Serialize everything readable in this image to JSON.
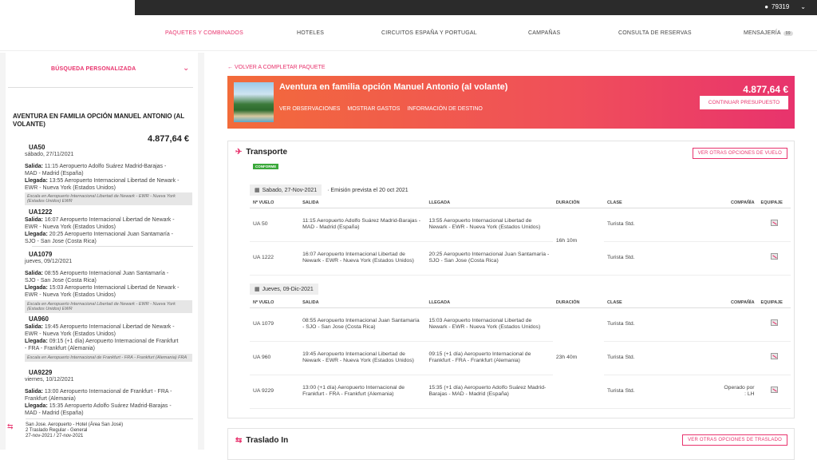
{
  "topbar": {
    "user_id": "79319"
  },
  "nav": {
    "items": [
      "PAQUETES Y COMBINADOS",
      "HOTELES",
      "CIRCUITOS ESPAÑA Y PORTUGAL",
      "CAMPAÑAS",
      "CONSULTA DE RESERVAS",
      "MENSAJERÍA"
    ],
    "badge": "99"
  },
  "sidebar": {
    "title": "BÚSQUEDA PERSONALIZADA",
    "trip_title": "AVENTURA EN FAMILIA OPCIÓN MANUEL ANTONIO (AL VOLANTE)",
    "price": "4.877,64 €",
    "salida_label": "Salida:",
    "llegada_label": "Llegada:",
    "legs": [
      {
        "code": "UA50",
        "date": "sábado, 27/11/2021",
        "salida": "11:15 Aeropuerto Adolfo Suárez Madrid-Barajas - MAD - Madrid (España)",
        "llegada": "13:55 Aeropuerto Internacional Libertad de Newark - EWR - Nueva York (Estados Unidos)",
        "stop": "Escala en Aeropuerto Internacional Libertad de Newark - EWR - Nueva York (Estados Unidos) EWR"
      },
      {
        "code": "UA1222",
        "date": "",
        "salida": "16:07 Aeropuerto Internacional Libertad de Newark - EWR - Nueva York (Estados Unidos)",
        "llegada": "20:25 Aeropuerto Internacional Juan Santamaría - SJO - San Jose (Costa Rica)",
        "stop": ""
      },
      {
        "code": "UA1079",
        "date": "jueves, 09/12/2021",
        "salida": "08:55 Aeropuerto Internacional Juan Santamaría - SJO - San Jose (Costa Rica)",
        "llegada": "15:03 Aeropuerto Internacional Libertad de Newark - EWR - Nueva York (Estados Unidos)",
        "stop": "Escala en Aeropuerto Internacional Libertad de Newark - EWR - Nueva York (Estados Unidos) EWR"
      },
      {
        "code": "UA960",
        "date": "",
        "salida": "19:45 Aeropuerto Internacional Libertad de Newark - EWR - Nueva York (Estados Unidos)",
        "llegada": "09:15 (+1 día) Aeropuerto Internacional de Frankfurt - FRA - Frankfurt (Alemania)",
        "stop": "Escala en Aeropuerto Internacional de Frankfurt - FRA - Frankfurt (Alemania) FRA"
      },
      {
        "code": "UA9229",
        "date": "viernes, 10/12/2021",
        "salida": "13:00 Aeropuerto Internacional de Frankfurt - FRA - Frankfurt (Alemania)",
        "llegada": "15:35 Aeropuerto Adolfo Suárez Madrid-Barajas - MAD - Madrid (España)",
        "stop": ""
      }
    ],
    "transfer": {
      "title": "San Jose. Aeropuerto - Hotel (Área San José)",
      "line2": "2 Traslado Regular - General",
      "dates": "27-nov-2021 / 27-nov-2021"
    }
  },
  "main": {
    "back_link": "VOLVER A COMPLETAR PAQUETE",
    "hero": {
      "title": "Aventura en familia opción Manuel Antonio (al volante)",
      "links": [
        "VER OBSERVACIONES",
        "MOSTRAR GASTOS",
        "INFORMACIÓN DE DESTINO"
      ],
      "price": "4.877,64 €",
      "button": "CONTINUAR PRESUPUESTO"
    },
    "transport": {
      "title": "Transporte",
      "options_button": "VER OTRAS OPCIONES DE VUELO",
      "status": "CONFORME",
      "columns": [
        "Nº VUELO",
        "SALIDA",
        "LLEGADA",
        "DURACIÓN",
        "CLASE",
        "COMPAÑÍA",
        "EQUIPAJE"
      ],
      "groups": [
        {
          "date": "Sabado, 27-Nov-2021",
          "note": "· Emisión prevista el 20 oct 2021",
          "duration": "16h 10m",
          "rows": [
            {
              "flight": "UA 50",
              "salida": "11:15  Aeropuerto Adolfo Suárez Madrid-Barajas - MAD - Madrid (España)",
              "llegada": "13:55  Aeropuerto Internacional Libertad de Newark - EWR - Nueva York (Estados Unidos)",
              "clase": "Turista Std.",
              "compania": ""
            },
            {
              "flight": "UA 1222",
              "salida": "16:07  Aeropuerto Internacional Libertad de Newark - EWR - Nueva York (Estados Unidos)",
              "llegada": "20:25  Aeropuerto Internacional Juan Santamaría - SJO - San Jose (Costa Rica)",
              "clase": "Turista Std.",
              "compania": ""
            }
          ]
        },
        {
          "date": "Jueves, 09-Dic-2021",
          "note": "",
          "duration": "23h 40m",
          "rows": [
            {
              "flight": "UA 1079",
              "salida": "08:55  Aeropuerto Internacional Juan Santamaría - SJO - San Jose (Costa Rica)",
              "llegada": "15:03  Aeropuerto Internacional Libertad de Newark - EWR - Nueva York (Estados Unidos)",
              "clase": "Turista Std.",
              "compania": ""
            },
            {
              "flight": "UA 960",
              "salida": "19:45  Aeropuerto Internacional Libertad de Newark - EWR - Nueva York (Estados Unidos)",
              "llegada": "09:15 (+1 día) Aeropuerto Internacional de Frankfurt - FRA - Frankfurt (Alemania)",
              "clase": "Turista Std.",
              "compania": ""
            },
            {
              "flight": "UA 9229",
              "salida": "13:00 (+1 día) Aeropuerto Internacional de Frankfurt - FRA - Frankfurt (Alemania)",
              "llegada": "15:35 (+1 día) Aeropuerto Adolfo Suárez Madrid-Barajas - MAD - Madrid (España)",
              "clase": "Turista Std.",
              "compania": "Operado por : LH"
            }
          ]
        }
      ]
    },
    "traslado": {
      "title": "Traslado In",
      "options_button": "VER OTRAS OPCIONES DE TRASLADO"
    }
  }
}
